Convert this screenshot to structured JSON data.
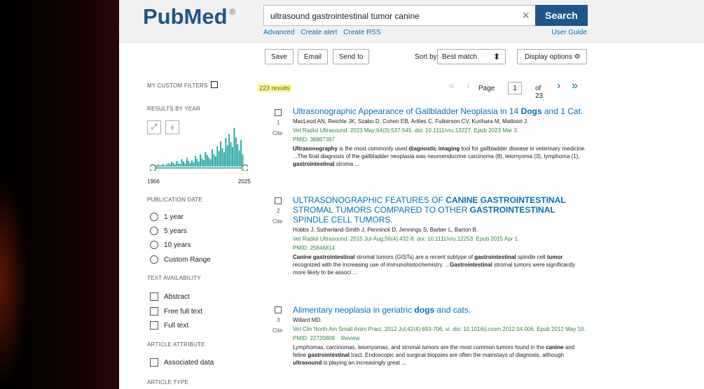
{
  "header": {
    "logo_text": "PubMed",
    "logo_reg": "®",
    "search_value": "ultrasound gastrointestinal tumor canine",
    "clear_symbol": "×",
    "search_button": "Search",
    "links": [
      "Advanced",
      "Create alert",
      "Create RSS"
    ],
    "user_guide": "User Guide"
  },
  "toolbar": {
    "save": "Save",
    "email": "Email",
    "send_to": "Send to",
    "sort_label": "Sort by:",
    "sort_value": "Best match",
    "display_options": "Display options"
  },
  "sidebar": {
    "custom_filters": "MY CUSTOM FILTERS",
    "results_by_year": "RESULTS BY YEAR",
    "year_start": "1966",
    "year_end": "2025",
    "publication_date": "PUBLICATION DATE",
    "date_options": [
      "1 year",
      "5 years",
      "10 years",
      "Custom Range"
    ],
    "text_availability": "TEXT AVAILABILITY",
    "text_options": [
      "Abstract",
      "Free full text",
      "Full text"
    ],
    "article_attribute": "ARTICLE ATTRIBUTE",
    "attribute_options": [
      "Associated data"
    ],
    "article_type": "ARTICLE TYPE"
  },
  "results_bar": {
    "count": "223 results",
    "page_label": "Page",
    "page_value": "1",
    "page_total": "of 23"
  },
  "results": [
    {
      "num": "1",
      "cite": "Cite",
      "title_parts": [
        "Ultrasonographic Appearance of Gallbladder Neoplasia in 14 ",
        "Dogs",
        " and 1 Cat."
      ],
      "authors": "MacLeod AN, Reichle JK, Szabo D, Cohen EB, Artiles C, Fulkerson CV, Kurihara M, Mattoon J.",
      "journal": "Vet Radiol Ultrasound. 2023 May;64(3):537-545. doi: 10.1111/vru.13227. Epub 2023 Mar 3.",
      "pmid": "PMID: 36867397",
      "snippet_parts": [
        "Ultrasonography",
        " is the most commonly used ",
        "diagnostic imaging",
        " tool for gallbladder disease in veterinary medicine. ...The final diagnosis of the gallbladder neoplasia was neuroendocrine carcinoma (8), leiomyoma (3), lymphoma (1), ",
        "gastrointestinal",
        " stroma ..."
      ]
    },
    {
      "num": "2",
      "cite": "Cite",
      "title_parts": [
        "ULTRASONOGRAPHIC FEATURES OF ",
        "CANINE GASTROINTESTINAL",
        " STROMAL TUMORS COMPARED TO OTHER ",
        "GASTROINTESTINAL",
        " SPINDLE CELL TUMORS."
      ],
      "authors": "Hobbs J, Sutherland-Smith J, Penninck D, Jennings S, Barber L, Barton B.",
      "journal": "Vet Radiol Ultrasound. 2015 Jul-Aug;56(4):432-8. doi: 10.1111/vru.12253. Epub 2015 Apr 1.",
      "pmid": "PMID: 25846814",
      "snippet_parts": [
        "Canine gastrointestinal",
        " stromal tumors (GISTs) are a recent subtype of ",
        "gastrointestinal",
        " spindle cell ",
        "tumor",
        " recognized with the increasing use of immunohistochemistry. ...",
        "Gastrointestinal",
        " stromal tumors were significantly more likely to be associ ..."
      ]
    },
    {
      "num": "3",
      "cite": "Cite",
      "title_parts": [
        "Alimentary neoplasia in geriatric ",
        "dogs",
        " and cats."
      ],
      "authors": "Willard MD.",
      "journal": "Vet Clin North Am Small Anim Pract. 2012 Jul;42(4):693-706, vi. doi: 10.1016/j.cvsm.2012.04.006. Epub 2012 May 10.",
      "pmid": "PMID: 22720809",
      "pub_type": "Review.",
      "snippet_parts": [
        "Lymphomas, carcinomas, leiomyomas, and stromal tumors are the most common tumors found in the ",
        "canine",
        " and feline ",
        "gastrointestinal",
        " tract. Endoscopic and surgical biopsies are often the mainstays of diagnosis, although ",
        "ultrasound",
        " is playing an increasingly great ..."
      ]
    }
  ],
  "colors": {
    "brand": "#20558a",
    "link": "#0071bc",
    "green": "#2e8540",
    "histogram": "#20a39e"
  },
  "histogram_heights": [
    0.04,
    0.03,
    0.05,
    0.03,
    0.04,
    0.06,
    0.03,
    0.05,
    0.08,
    0.06,
    0.12,
    0.09,
    0.05,
    0.14,
    0.08,
    0.06,
    0.18,
    0.12,
    0.07,
    0.22,
    0.14,
    0.09,
    0.15,
    0.1,
    0.26,
    0.19,
    0.12,
    0.3,
    0.2,
    0.16,
    0.36,
    0.28,
    0.22,
    0.18,
    0.42,
    0.3,
    0.25,
    0.5,
    0.38,
    0.62,
    0.45,
    0.35,
    0.7,
    0.52,
    0.8,
    0.6,
    0.48,
    0.95,
    0.72,
    0.55,
    0.4,
    0.65,
    0.3
  ]
}
